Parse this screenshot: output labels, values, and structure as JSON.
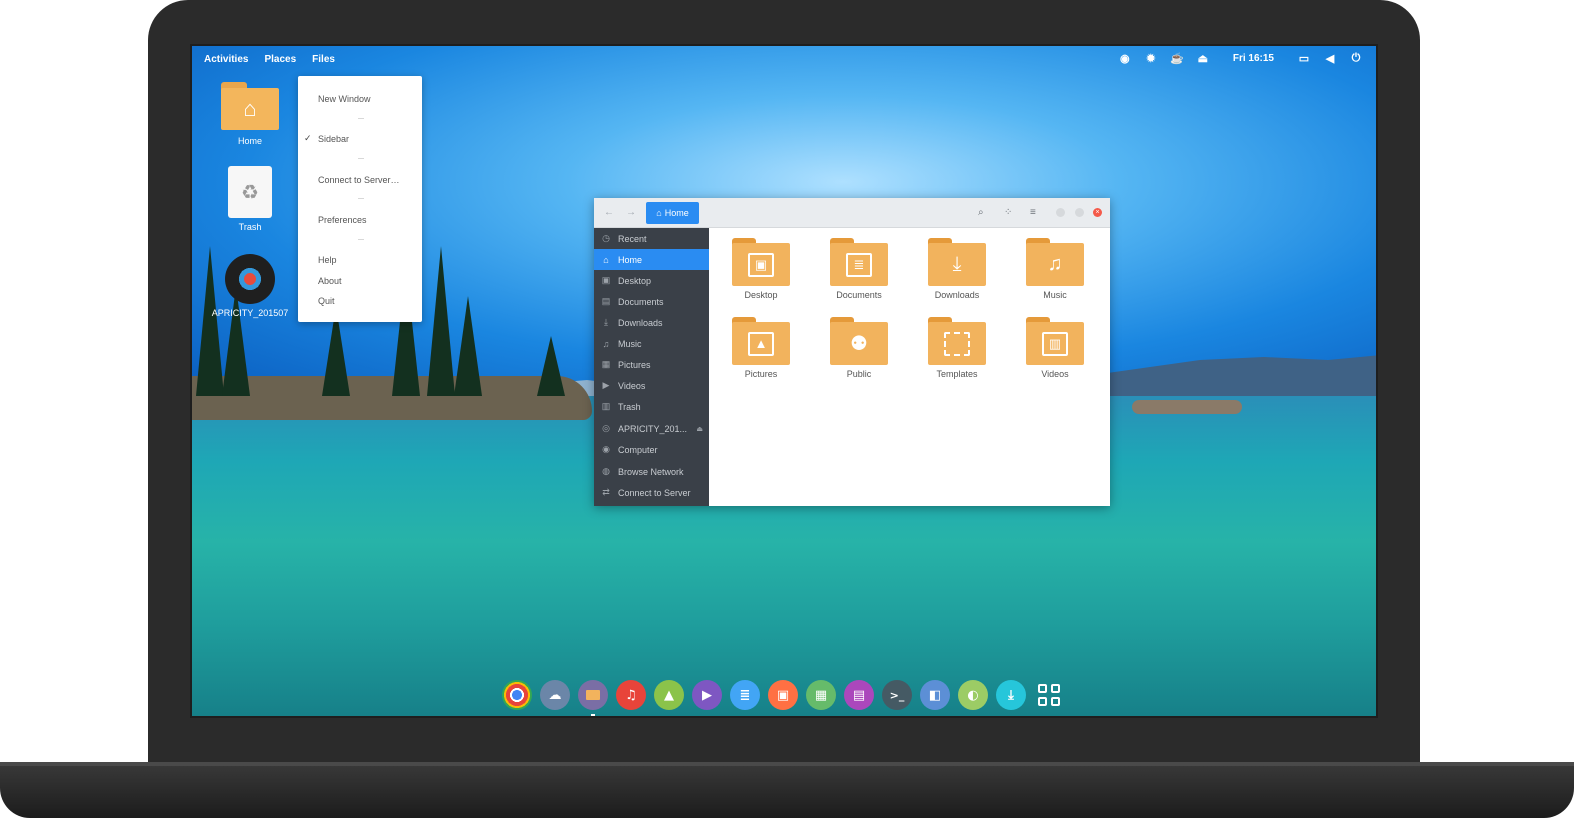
{
  "topbar": {
    "activities": "Activities",
    "places": "Places",
    "files": "Files",
    "clock": "Fri 16:15"
  },
  "files_menu": {
    "items": [
      "New Window",
      "Sidebar",
      "Connect to Server…",
      "Preferences",
      "Help",
      "About",
      "Quit"
    ],
    "checked": "Sidebar"
  },
  "desktop_icons": {
    "home": "Home",
    "trash": "Trash",
    "disc": "APRICITY_201507"
  },
  "file_manager": {
    "path_label": "Home",
    "sidebar": [
      {
        "label": "Recent",
        "icon": "clock-icon"
      },
      {
        "label": "Home",
        "icon": "home-icon",
        "active": true
      },
      {
        "label": "Desktop",
        "icon": "desktop-icon"
      },
      {
        "label": "Documents",
        "icon": "document-icon"
      },
      {
        "label": "Downloads",
        "icon": "download-icon"
      },
      {
        "label": "Music",
        "icon": "music-icon"
      },
      {
        "label": "Pictures",
        "icon": "picture-icon"
      },
      {
        "label": "Videos",
        "icon": "video-icon"
      },
      {
        "label": "Trash",
        "icon": "trash-icon"
      },
      {
        "label": "APRICITY_201...",
        "icon": "disc-icon"
      },
      {
        "label": "Computer",
        "icon": "computer-icon"
      },
      {
        "label": "Browse Network",
        "icon": "network-icon"
      },
      {
        "label": "Connect to Server",
        "icon": "server-icon"
      }
    ],
    "folders": [
      {
        "label": "Desktop",
        "icon": "desktop-icon"
      },
      {
        "label": "Documents",
        "icon": "document-icon"
      },
      {
        "label": "Downloads",
        "icon": "download-icon"
      },
      {
        "label": "Music",
        "icon": "music-icon"
      },
      {
        "label": "Pictures",
        "icon": "picture-icon"
      },
      {
        "label": "Public",
        "icon": "people-icon"
      },
      {
        "label": "Templates",
        "icon": "template-icon"
      },
      {
        "label": "Videos",
        "icon": "film-icon"
      }
    ]
  },
  "dock": [
    {
      "name": "chrome",
      "color": "#e8443a"
    },
    {
      "name": "cloud",
      "color": "#6b86a8"
    },
    {
      "name": "files",
      "color": "#7a6ea5"
    },
    {
      "name": "music",
      "color": "#e8443a"
    },
    {
      "name": "photos",
      "color": "#8bc34a"
    },
    {
      "name": "video",
      "color": "#7e57c2"
    },
    {
      "name": "writer",
      "color": "#42a5f5"
    },
    {
      "name": "impress",
      "color": "#ff7043"
    },
    {
      "name": "calc",
      "color": "#66bb6a"
    },
    {
      "name": "document",
      "color": "#ab47bc"
    },
    {
      "name": "terminal",
      "color": "#455a64"
    },
    {
      "name": "window",
      "color": "#5c8fd6"
    },
    {
      "name": "settings",
      "color": "#9ccc65"
    },
    {
      "name": "software",
      "color": "#26c6da"
    }
  ],
  "colors": {
    "accent": "#2a8cf2",
    "folder": "#f2b35d",
    "sidebar_bg": "#3a4048"
  }
}
